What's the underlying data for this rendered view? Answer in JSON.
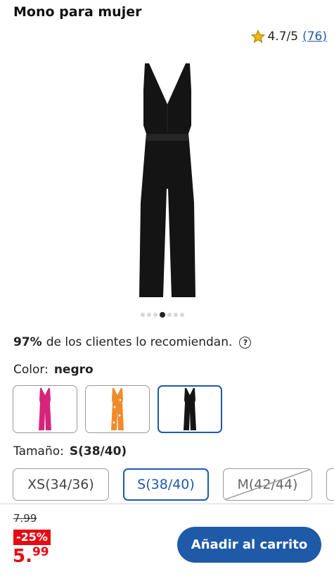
{
  "product": {
    "title": "Mono para mujer",
    "rating": "4.7/5",
    "review_count": "(76)",
    "image_icon": "jumpsuit-black-icon"
  },
  "gallery": {
    "total": 7,
    "active_index": 4
  },
  "recommend": {
    "percent": "97%",
    "text": "de los clientes lo recomiendan.",
    "help_symbol": "?"
  },
  "color": {
    "label": "Color:",
    "selected": "negro",
    "swatches": [
      {
        "name": "pink",
        "hex": "#d6247a"
      },
      {
        "name": "orange-floral",
        "hex": "#f08a2c"
      },
      {
        "name": "black",
        "hex": "#141414"
      }
    ]
  },
  "size": {
    "label": "Tamaño:",
    "selected": "S(38/40)",
    "options": [
      "XS(34/36)",
      "S(38/40)",
      "M(42/44)"
    ]
  },
  "pricing": {
    "old_price": "7.99",
    "discount": "-25%",
    "price_main": "5.",
    "price_cents": "99"
  },
  "cart": {
    "label": "Añadir al carrito"
  },
  "colors": {
    "accent": "#1f5aa8",
    "sale": "#e60a14",
    "star": "#f2b700"
  }
}
